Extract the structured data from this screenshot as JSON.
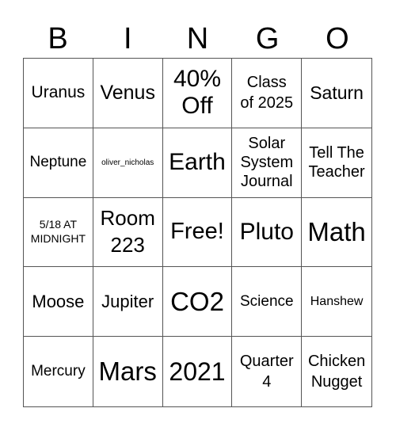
{
  "header": {
    "letters": [
      "B",
      "I",
      "N",
      "G",
      "O"
    ]
  },
  "cells": [
    {
      "text": "Uranus"
    },
    {
      "text": "Venus"
    },
    {
      "text": "40%\nOff"
    },
    {
      "text": "Class\nof 2025"
    },
    {
      "text": "Saturn"
    },
    {
      "text": "Neptune"
    },
    {
      "text": "oliver_nicholas"
    },
    {
      "text": "Earth"
    },
    {
      "text": "Solar\nSystem\nJournal"
    },
    {
      "text": "Tell The\nTeacher"
    },
    {
      "text": "5/18 AT\nMIDNIGHT"
    },
    {
      "text": "Room\n223"
    },
    {
      "text": "Free!"
    },
    {
      "text": "Pluto"
    },
    {
      "text": "Math"
    },
    {
      "text": "Moose"
    },
    {
      "text": "Jupiter"
    },
    {
      "text": "CO2"
    },
    {
      "text": "Science"
    },
    {
      "text": "Hanshew"
    },
    {
      "text": "Mercury"
    },
    {
      "text": "Mars"
    },
    {
      "text": "2021"
    },
    {
      "text": "Quarter\n4"
    },
    {
      "text": "Chicken\nNugget"
    }
  ]
}
